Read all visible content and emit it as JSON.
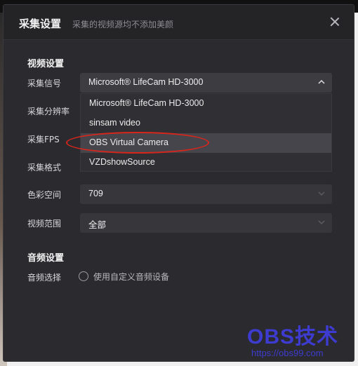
{
  "dialog": {
    "title": "采集设置",
    "subtitle": "采集的视频源均不添加美颜",
    "close_icon": "close-icon"
  },
  "video_section": {
    "title": "视频设置",
    "rows": [
      {
        "label": "采集信号",
        "value": "Microsoft® LifeCam HD-3000",
        "expanded": true
      },
      {
        "label": "采集分辨率",
        "value": ""
      },
      {
        "label": "采集FPS",
        "value": ""
      },
      {
        "label": "采集格式",
        "value": ""
      },
      {
        "label": "色彩空间",
        "value": "709"
      },
      {
        "label": "视频范围",
        "value": "全部"
      }
    ],
    "dropdown_options": [
      "Microsoft® LifeCam HD-3000",
      "sinsam video",
      "OBS Virtual Camera",
      "VZDshowSource"
    ],
    "hovered_option": "OBS Virtual Camera"
  },
  "audio_section": {
    "title": "音频设置",
    "row_label": "音频选择",
    "radio_label": "使用自定义音频设备",
    "radio_checked": false
  },
  "watermark": {
    "logo_text": "OBS技术",
    "url": "https://obs99.com"
  },
  "colors": {
    "dialog_bg": "#2b2b2f",
    "annotation_red": "#d9261c",
    "watermark_blue": "#3d3bd0"
  }
}
